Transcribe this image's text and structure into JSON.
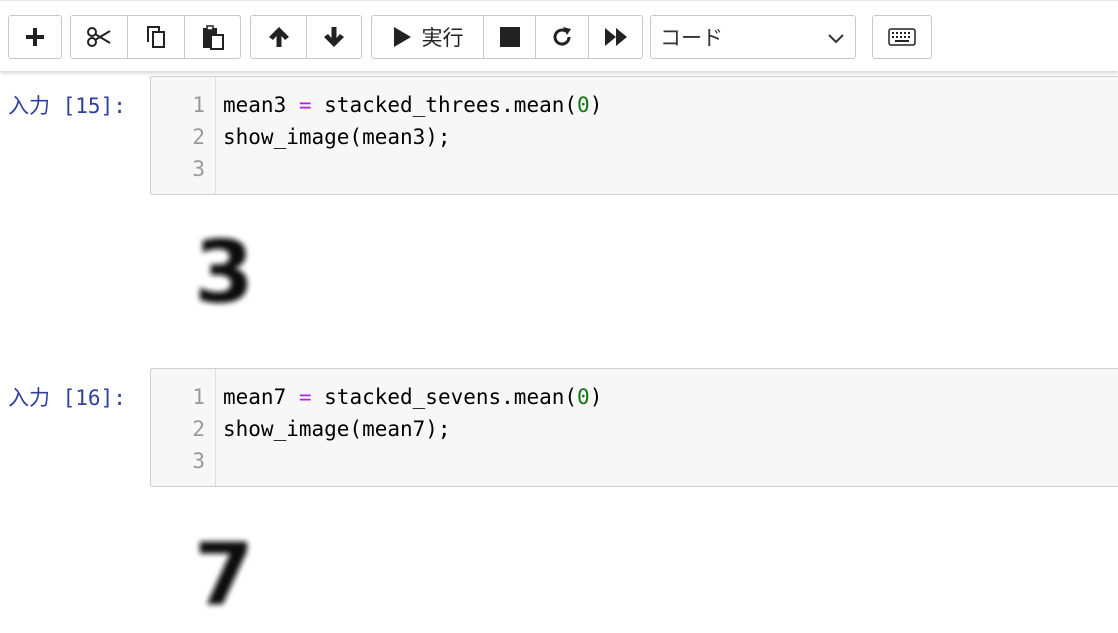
{
  "toolbar": {
    "run_label": "実行",
    "cell_type_value": "コード",
    "icons": [
      "plus-icon",
      "scissors-icon",
      "copy-icon",
      "paste-icon",
      "arrow-up-icon",
      "arrow-down-icon",
      "play-icon",
      "stop-icon",
      "restart-icon",
      "fast-forward-icon",
      "chevron-down-icon",
      "keyboard-icon"
    ]
  },
  "cells": [
    {
      "prompt": "入力 [15]:",
      "lines": [
        {
          "num": "1",
          "pre": "mean3 ",
          "op": "=",
          "mid": " stacked_threes.mean(",
          "lit": "0",
          "post": ")"
        },
        {
          "num": "2",
          "text": "show_image(mean3);"
        },
        {
          "num": "3",
          "text": ""
        }
      ],
      "output": {
        "glyph": "3"
      }
    },
    {
      "prompt": "入力 [16]:",
      "lines": [
        {
          "num": "1",
          "pre": "mean7 ",
          "op": "=",
          "mid": " stacked_sevens.mean(",
          "lit": "0",
          "post": ")"
        },
        {
          "num": "2",
          "text": "show_image(mean7);"
        },
        {
          "num": "3",
          "text": ""
        }
      ],
      "output": {
        "glyph": "7"
      }
    }
  ],
  "colors": {
    "prompt": "#303f9f",
    "operator": "#aa22ff",
    "number_literal": "#117711",
    "editor_bg": "#f7f7f7"
  }
}
